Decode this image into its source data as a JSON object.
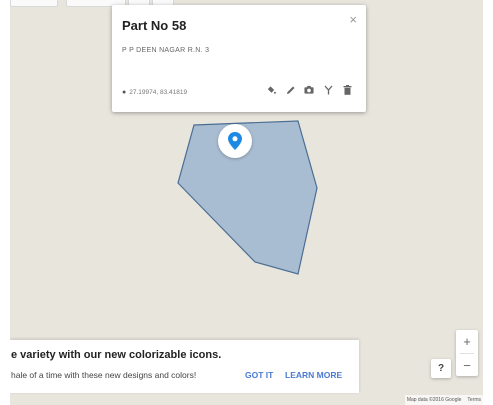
{
  "info_window": {
    "title": "Part No 58",
    "subtitle": "P P DEEN NAGAR R.N. 3",
    "coordinates": "27.19974, 83.41819",
    "close_label": "×",
    "tools": [
      "paint-bucket-icon",
      "pencil-icon",
      "camera-icon",
      "route-icon",
      "trash-icon"
    ]
  },
  "toast": {
    "line1": "e variety with our new colorizable icons.",
    "line2": "hale of a time with these new designs and colors!",
    "got_it": "GOT IT",
    "learn_more": "LEARN MORE"
  },
  "controls": {
    "zoom_in": "+",
    "zoom_out": "−",
    "help": "?"
  },
  "attribution": {
    "map_data": "Map data ©2016 Google",
    "terms": "Terms"
  },
  "colors": {
    "map_background": "#e8e5dd",
    "polygon_fill": "#a9bdd2",
    "polygon_stroke": "#4a6e93",
    "marker": "#1e88e5",
    "accent": "#4a7bd1"
  }
}
